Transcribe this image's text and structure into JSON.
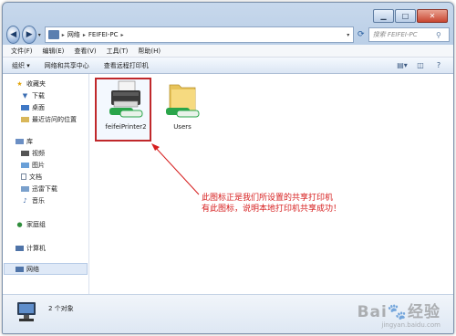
{
  "address": {
    "seg1": "网络",
    "seg2": "FEIFEI-PC"
  },
  "search": {
    "placeholder": "搜索 FEIFEI-PC"
  },
  "menu": [
    "文件(F)",
    "编辑(E)",
    "查看(V)",
    "工具(T)",
    "帮助(H)"
  ],
  "toolbar": {
    "organize": "组织 ▾",
    "network_center": "网络和共享中心",
    "view_printers": "查看远程打印机"
  },
  "sidebar": {
    "favorites": "收藏夹",
    "downloads": "下载",
    "desktop": "桌面",
    "recent": "最近访问的位置",
    "library": "库",
    "videos": "视频",
    "pictures": "图片",
    "documents": "文档",
    "xunlei": "迅雷下载",
    "music": "音乐",
    "homegroup": "家庭组",
    "computer": "计算机",
    "network": "网络"
  },
  "files": [
    {
      "label": "feifeiPrinter2",
      "icon": "shared-printer-icon"
    },
    {
      "label": "Users",
      "icon": "shared-folder-icon"
    }
  ],
  "annotation": {
    "line1": "此图标正是我们所设置的共享打印机",
    "line2": "有此图标，说明本地打印机共享成功！",
    "color": "#d61e1e"
  },
  "status": {
    "count": "2 个对象"
  },
  "watermark": {
    "brand": "Bai🐾经验",
    "url": "jingyan.baidu.com"
  }
}
